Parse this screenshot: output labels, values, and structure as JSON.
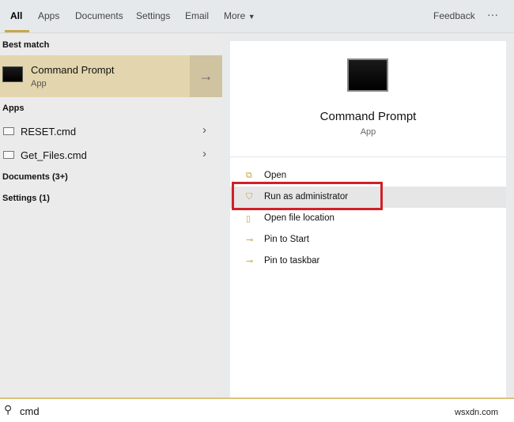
{
  "tabs": [
    {
      "label": "All"
    },
    {
      "label": "Apps"
    },
    {
      "label": "Documents"
    },
    {
      "label": "Settings"
    },
    {
      "label": "Email"
    },
    {
      "label": "More"
    }
  ],
  "feedback": "Feedback",
  "more_options": "···",
  "best_match": {
    "heading": "Best match",
    "title": "Command Prompt",
    "subtitle": "App"
  },
  "apps": {
    "heading": "Apps",
    "items": [
      {
        "label": "RESET.cmd"
      },
      {
        "label": "Get_Files.cmd"
      }
    ]
  },
  "documents": "Documents (3+)",
  "settings": "Settings (1)",
  "preview": {
    "title": "Command Prompt",
    "subtitle": "App"
  },
  "actions": [
    {
      "label": "Open"
    },
    {
      "label": "Run as administrator"
    },
    {
      "label": "Open file location"
    },
    {
      "label": "Pin to Start"
    },
    {
      "label": "Pin to taskbar"
    }
  ],
  "search": {
    "value": "cmd"
  },
  "watermark": "wsxdn.com",
  "colors": {
    "accent": "#c9a74a",
    "highlight": "#d0202a"
  }
}
